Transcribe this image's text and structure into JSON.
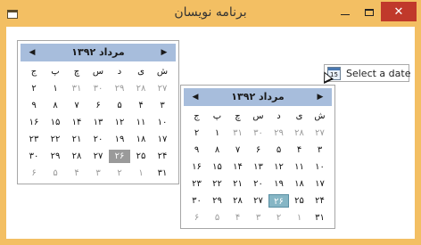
{
  "window": {
    "title": "برنامه نویسان",
    "close_glyph": "✕"
  },
  "calendars": [
    {
      "month_title": "مرداد ۱۳۹۲",
      "weekdays": [
        "ش",
        "ی",
        "د",
        "س",
        "چ",
        "پ",
        "ج"
      ],
      "rows": [
        [
          {
            "t": "۲۷",
            "o": true
          },
          {
            "t": "۲۸",
            "o": true
          },
          {
            "t": "۲۹",
            "o": true
          },
          {
            "t": "۳۰",
            "o": true
          },
          {
            "t": "۳۱",
            "o": true
          },
          {
            "t": "۱"
          },
          {
            "t": "۲"
          }
        ],
        [
          {
            "t": "۳"
          },
          {
            "t": "۴"
          },
          {
            "t": "۵"
          },
          {
            "t": "۶"
          },
          {
            "t": "۷"
          },
          {
            "t": "۸"
          },
          {
            "t": "۹"
          }
        ],
        [
          {
            "t": "۱۰"
          },
          {
            "t": "۱۱"
          },
          {
            "t": "۱۲"
          },
          {
            "t": "۱۳"
          },
          {
            "t": "۱۴"
          },
          {
            "t": "۱۵"
          },
          {
            "t": "۱۶"
          }
        ],
        [
          {
            "t": "۱۷"
          },
          {
            "t": "۱۸"
          },
          {
            "t": "۱۹"
          },
          {
            "t": "۲۰"
          },
          {
            "t": "۲۱"
          },
          {
            "t": "۲۲"
          },
          {
            "t": "۲۳"
          }
        ],
        [
          {
            "t": "۲۴"
          },
          {
            "t": "۲۵"
          },
          {
            "t": "۲۶",
            "s": "today"
          },
          {
            "t": "۲۷"
          },
          {
            "t": "۲۸"
          },
          {
            "t": "۲۹"
          },
          {
            "t": "۳۰"
          }
        ],
        [
          {
            "t": "۳۱"
          },
          {
            "t": "۱",
            "o": true
          },
          {
            "t": "۲",
            "o": true
          },
          {
            "t": "۳",
            "o": true
          },
          {
            "t": "۴",
            "o": true
          },
          {
            "t": "۵",
            "o": true
          },
          {
            "t": "۶",
            "o": true
          }
        ]
      ]
    },
    {
      "month_title": "مرداد ۱۳۹۲",
      "weekdays": [
        "ش",
        "ی",
        "د",
        "س",
        "چ",
        "پ",
        "ج"
      ],
      "rows": [
        [
          {
            "t": "۲۷",
            "o": true
          },
          {
            "t": "۲۸",
            "o": true
          },
          {
            "t": "۲۹",
            "o": true
          },
          {
            "t": "۳۰",
            "o": true
          },
          {
            "t": "۳۱",
            "o": true
          },
          {
            "t": "۱"
          },
          {
            "t": "۲"
          }
        ],
        [
          {
            "t": "۳"
          },
          {
            "t": "۴"
          },
          {
            "t": "۵"
          },
          {
            "t": "۶"
          },
          {
            "t": "۷"
          },
          {
            "t": "۸"
          },
          {
            "t": "۹"
          }
        ],
        [
          {
            "t": "۱۰"
          },
          {
            "t": "۱۱"
          },
          {
            "t": "۱۲"
          },
          {
            "t": "۱۳"
          },
          {
            "t": "۱۴"
          },
          {
            "t": "۱۵"
          },
          {
            "t": "۱۶"
          }
        ],
        [
          {
            "t": "۱۷"
          },
          {
            "t": "۱۸"
          },
          {
            "t": "۱۹"
          },
          {
            "t": "۲۰"
          },
          {
            "t": "۲۱"
          },
          {
            "t": "۲۲"
          },
          {
            "t": "۲۳"
          }
        ],
        [
          {
            "t": "۲۴"
          },
          {
            "t": "۲۵"
          },
          {
            "t": "۲۶",
            "s": "sel"
          },
          {
            "t": "۲۷"
          },
          {
            "t": "۲۸"
          },
          {
            "t": "۲۹"
          },
          {
            "t": "۳۰"
          }
        ],
        [
          {
            "t": "۳۱"
          },
          {
            "t": "۱",
            "o": true
          },
          {
            "t": "۲",
            "o": true
          },
          {
            "t": "۳",
            "o": true
          },
          {
            "t": "۴",
            "o": true
          },
          {
            "t": "۵",
            "o": true
          },
          {
            "t": "۶",
            "o": true
          }
        ]
      ]
    }
  ],
  "date_picker": {
    "placeholder": "Select a date",
    "icon_number": "15"
  },
  "colors": {
    "title_bar": "#f3bf63",
    "close_button": "#c0392b",
    "calendar_header": "#a7bddc",
    "today_highlight": "#9a9a9a",
    "selected_highlight": "#86b6c5"
  }
}
